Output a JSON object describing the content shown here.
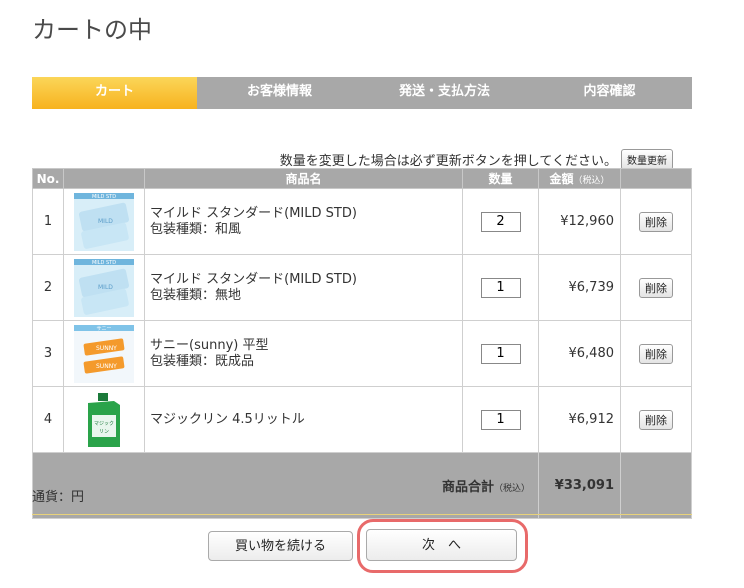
{
  "page": {
    "title": "カートの中"
  },
  "steps": [
    {
      "label": "カート",
      "active": true
    },
    {
      "label": "お客様情報",
      "active": false
    },
    {
      "label": "発送・支払方法",
      "active": false
    },
    {
      "label": "内容確認",
      "active": false
    }
  ],
  "notice": {
    "text": "数量を変更した場合は必ず更新ボタンを押してください。",
    "update_button": "数量更新"
  },
  "table": {
    "headers": {
      "no": "No.",
      "name": "商品名",
      "qty": "数量",
      "price": "金額",
      "price_tax_note": "（税込）"
    },
    "rows": [
      {
        "no": "1",
        "name": "マイルド スタンダード(MILD STD)",
        "sub": "包装種類：和風",
        "qty": "2",
        "price": "¥12,960",
        "delete": "削除",
        "image": "mild-product"
      },
      {
        "no": "2",
        "name": "マイルド スタンダード(MILD STD)",
        "sub": "包装種類：無地",
        "qty": "1",
        "price": "¥6,739",
        "delete": "削除",
        "image": "mild-product"
      },
      {
        "no": "3",
        "name": "サニー(sunny) 平型",
        "sub": "包装種類：既成品",
        "qty": "1",
        "price": "¥6,480",
        "delete": "削除",
        "image": "sunny-product"
      },
      {
        "no": "4",
        "name": "マジックリン 4.5リットル",
        "sub": "",
        "qty": "1",
        "price": "¥6,912",
        "delete": "削除",
        "image": "magiclean-product"
      }
    ],
    "total": {
      "label": "商品合計",
      "tax_note": "（税込）",
      "value": "¥33,091"
    }
  },
  "currency": {
    "label": "通貨：円"
  },
  "buttons": {
    "continue": "買い物を続ける",
    "next": "次　へ"
  },
  "colors": {
    "header_gray": "#a8a8a8",
    "active_step": "#f7b21e",
    "highlight": "#e86a6a"
  }
}
